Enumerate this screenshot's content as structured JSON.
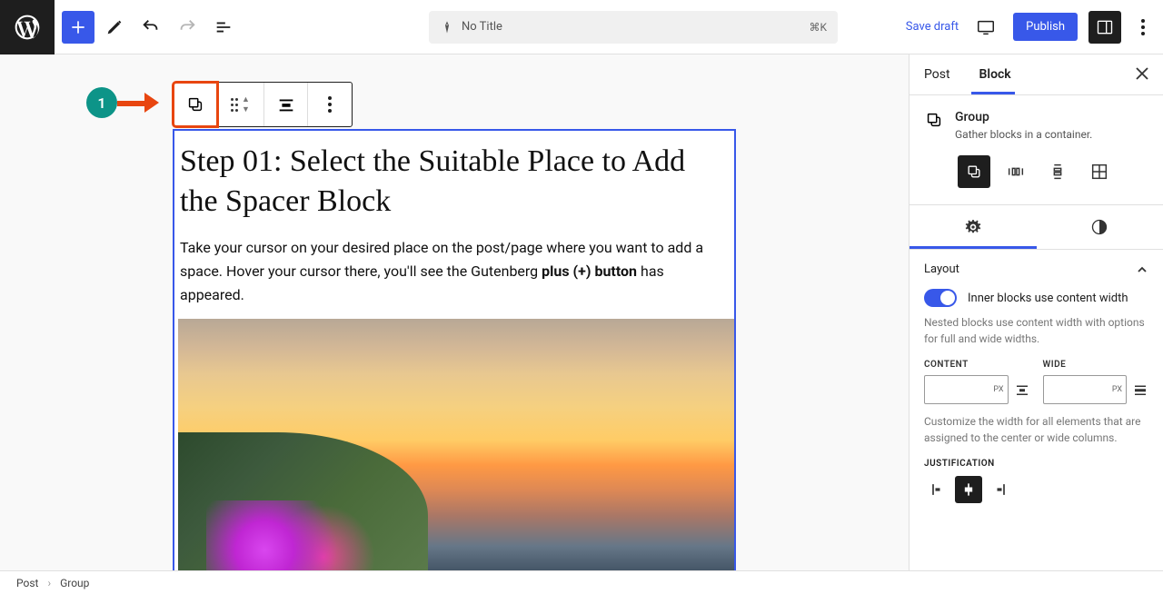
{
  "header": {
    "title": "No Title",
    "shortcut": "⌘K",
    "save_draft": "Save draft",
    "publish": "Publish"
  },
  "annotation": {
    "number": "1"
  },
  "content": {
    "heading": "Step 01: Select the Suitable Place to Add the Spacer Block",
    "para_before": "Take your cursor on your desired place on the post/page where you want to add a space. Hover your cursor there, you'll see the Gutenberg ",
    "para_bold": "plus (+) button",
    "para_after": " has appeared."
  },
  "sidebar": {
    "tabs": {
      "post": "Post",
      "block": "Block"
    },
    "block_name": "Group",
    "block_desc": "Gather blocks in a container.",
    "layout": {
      "title": "Layout",
      "toggle_label": "Inner blocks use content width",
      "toggle_help": "Nested blocks use content width with options for full and wide widths.",
      "content_label": "CONTENT",
      "wide_label": "WIDE",
      "unit": "PX",
      "width_help": "Customize the width for all elements that are assigned to the center or wide columns.",
      "justification_label": "JUSTIFICATION"
    }
  },
  "footer": {
    "crumb1": "Post",
    "crumb2": "Group"
  }
}
